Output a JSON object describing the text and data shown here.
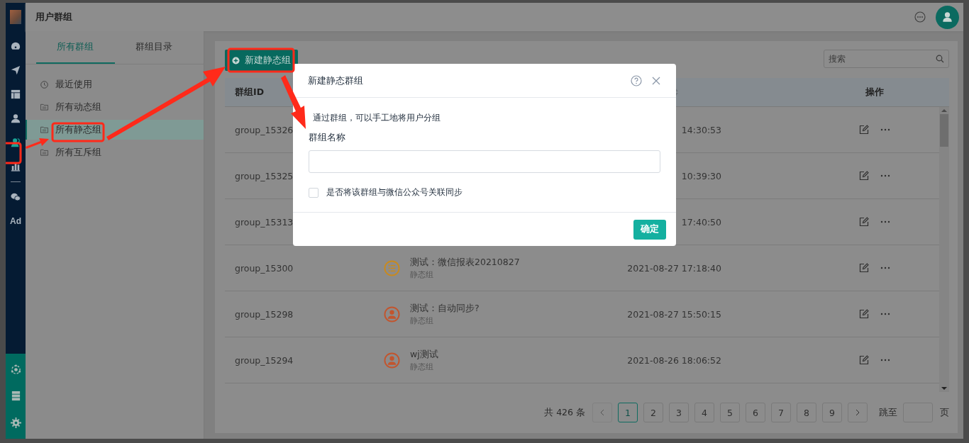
{
  "nav": {
    "items": [
      {
        "kind": "logo"
      },
      {
        "kind": "dashboard",
        "selected": false
      },
      {
        "kind": "send",
        "selected": false
      },
      {
        "kind": "layout",
        "selected": false
      },
      {
        "kind": "user",
        "selected": false
      },
      {
        "kind": "group",
        "selected": true
      },
      {
        "kind": "chart",
        "selected": false
      },
      {
        "kind": "divider"
      },
      {
        "kind": "chat",
        "selected": false
      },
      {
        "kind": "text",
        "label": "Ad",
        "selected": false
      }
    ],
    "bottom_items": [
      {
        "kind": "network"
      },
      {
        "kind": "server"
      },
      {
        "kind": "gear"
      }
    ]
  },
  "header": {
    "title": "用户群组"
  },
  "left_panel": {
    "tabs": [
      {
        "label": "所有群组",
        "selected": true
      },
      {
        "label": "群组目录",
        "selected": false
      }
    ],
    "items": [
      {
        "kind": "clock",
        "label": "最近使用",
        "selected": false
      },
      {
        "kind": "folder",
        "label": "所有动态组",
        "selected": false
      },
      {
        "kind": "folder",
        "label": "所有静态组",
        "selected": true
      },
      {
        "kind": "folder",
        "label": "所有互斥组",
        "selected": false
      }
    ]
  },
  "toolbar": {
    "new_button": "新建静态组",
    "search": {
      "placeholder": "搜索"
    }
  },
  "table": {
    "columns": [
      "群组ID",
      "",
      "",
      "操作"
    ],
    "rows": [
      {
        "id": "group_15326",
        "time": "14:30:53"
      },
      {
        "id": "group_15325",
        "time": "10:39:30"
      },
      {
        "id": "group_15313",
        "time": "17:40:50"
      },
      {
        "id": "group_15300",
        "name": "测试：微信报表20210827",
        "type": "静态组",
        "kind": "list",
        "color": "#c98a1e",
        "time": "2021-08-27 17:18:40"
      },
      {
        "id": "group_15298",
        "name": "测试：自动同步?",
        "type": "静态组",
        "kind": "user",
        "color": "#c2552e",
        "time": "2021-08-27 15:50:15"
      },
      {
        "id": "group_15294",
        "name": "wj测试",
        "type": "静态组",
        "kind": "user",
        "color": "#c2552e",
        "time": "2021-08-26 18:06:52"
      }
    ]
  },
  "pagination": {
    "total": "共 426 条",
    "pages": [
      {
        "label": "1",
        "selected": true
      },
      {
        "label": "2",
        "selected": false
      },
      {
        "label": "3",
        "selected": false
      },
      {
        "label": "4",
        "selected": false
      },
      {
        "label": "5",
        "selected": false
      },
      {
        "label": "6",
        "selected": false
      },
      {
        "label": "7",
        "selected": false
      },
      {
        "label": "8",
        "selected": false
      },
      {
        "label": "9",
        "selected": false
      }
    ],
    "jump_label": "跳至",
    "page_unit": "页"
  },
  "dialog": {
    "title": "新建静态群组",
    "description": "通过群组，可以手工地将用户分组",
    "field_label": "群组名称",
    "checkbox": {
      "label": "是否将该群组与微信公众号关联同步",
      "checked": false
    },
    "confirm": "确定"
  }
}
